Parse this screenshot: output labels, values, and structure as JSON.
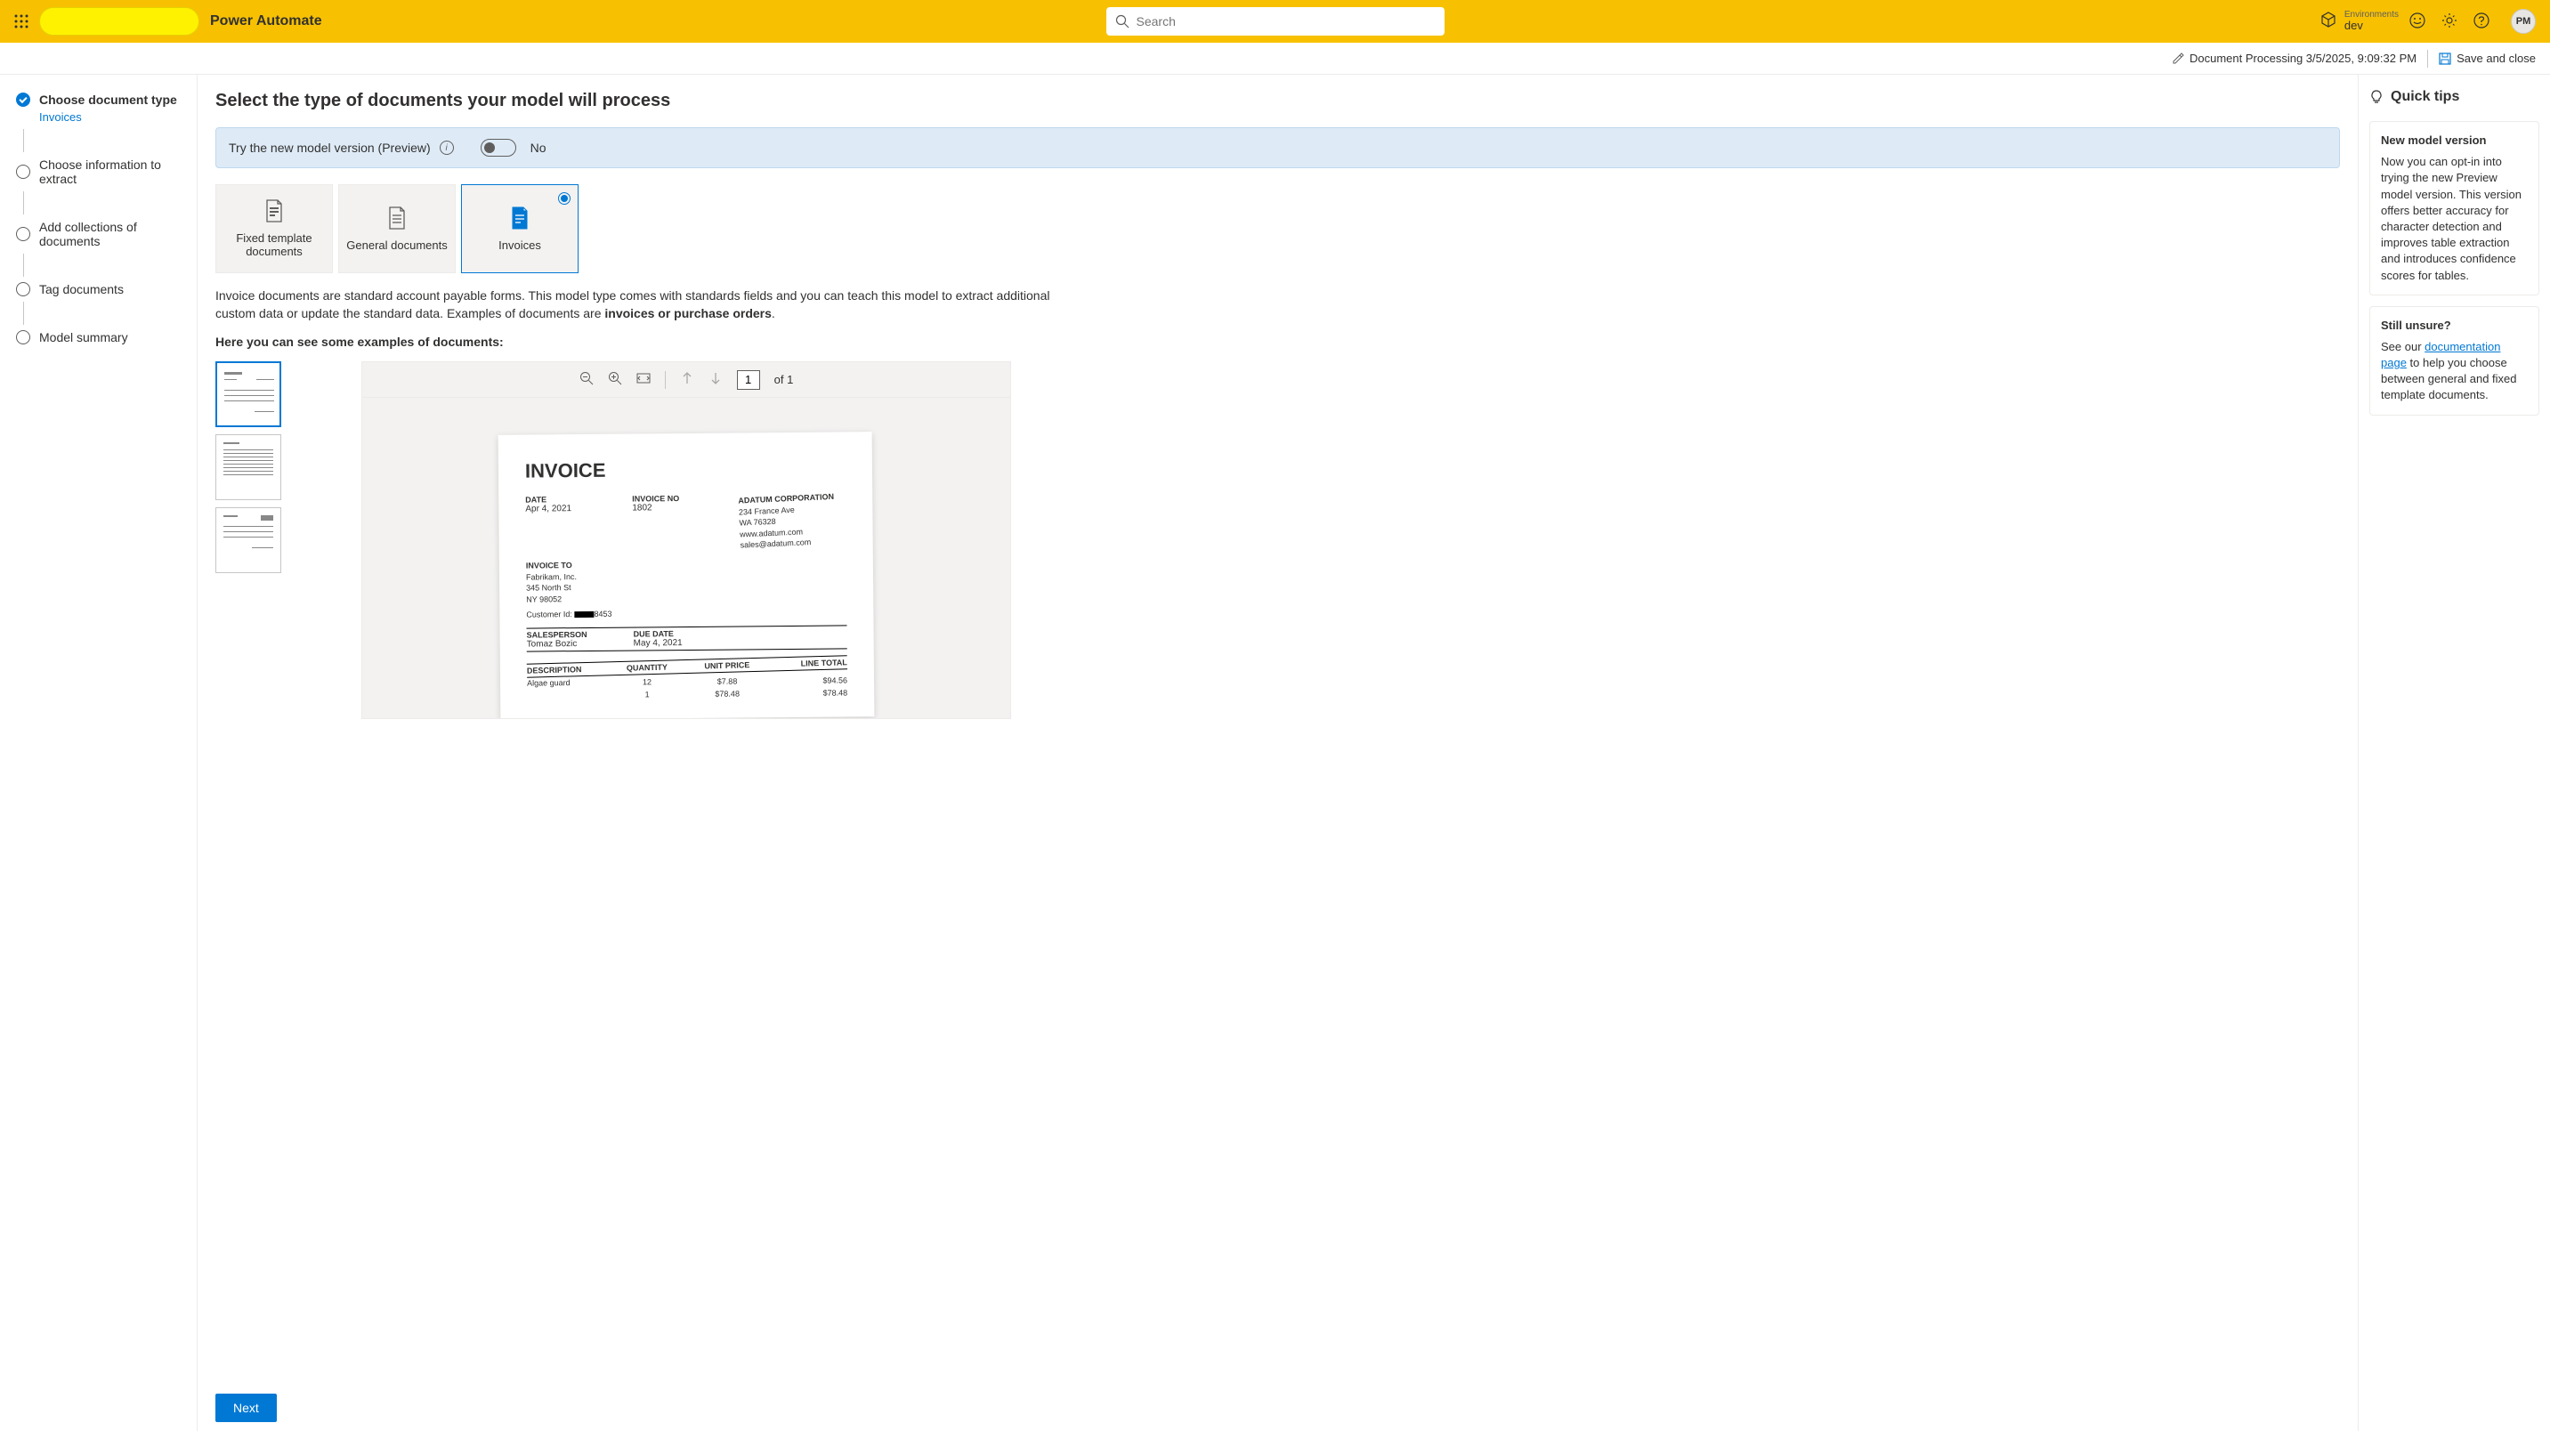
{
  "header": {
    "app_title": "Power Automate",
    "search_placeholder": "Search",
    "env_label": "Environments",
    "env_value": "dev",
    "avatar": "PM"
  },
  "subheader": {
    "doc_title": "Document Processing 3/5/2025, 9:09:32 PM",
    "save_close": "Save and close"
  },
  "sidebar": {
    "steps": [
      {
        "label": "Choose document type",
        "sub": "Invoices",
        "done": true
      },
      {
        "label": "Choose information to extract"
      },
      {
        "label": "Add collections of documents"
      },
      {
        "label": "Tag documents"
      },
      {
        "label": "Model summary"
      }
    ]
  },
  "main": {
    "heading": "Select the type of documents your model will process",
    "preview_text": "Try the new model version (Preview)",
    "toggle_state": "No",
    "cards": {
      "fixed": "Fixed template documents",
      "general": "General documents",
      "invoices": "Invoices"
    },
    "description1": "Invoice documents are standard account payable forms. This model type comes with standards fields and you can teach this model to extract additional custom data or update the standard data. Examples of documents are ",
    "description_bold": "invoices or purchase orders",
    "description_end": ".",
    "examples_label": "Here you can see some examples of documents:",
    "viewer": {
      "page_current": "1",
      "page_total": "of 1"
    },
    "footer": {
      "next": "Next"
    },
    "invoice_doc": {
      "title": "INVOICE",
      "date_lbl": "DATE",
      "date_val": "Apr 4, 2021",
      "inv_no_lbl": "INVOICE NO",
      "inv_no_val": "1802",
      "company": "ADATUM CORPORATION",
      "addr1": "234 France Ave",
      "addr2": "WA 76328",
      "web": "www.adatum.com",
      "email": "sales@adatum.com",
      "to_lbl": "INVOICE TO",
      "to1": "Fabrikam, Inc.",
      "to2": "345 North St",
      "to3": "NY 98052",
      "cust_lbl": "Customer Id:",
      "cust_val": "8453",
      "sales_lbl": "SALESPERSON",
      "sales_val": "Tomaz Bozic",
      "due_lbl": "DUE DATE",
      "due_val": "May 4, 2021",
      "th_desc": "DESCRIPTION",
      "th_qty": "QUANTITY",
      "th_price": "UNIT PRICE",
      "th_total": "LINE TOTAL",
      "r1_desc": "Algae guard",
      "r1_qty": "12",
      "r1_price": "$7.88",
      "r1_total": "$94.56",
      "r2_qty": "1",
      "r2_price": "$78.48",
      "r2_total": "$78.48"
    }
  },
  "tips": {
    "title": "Quick tips",
    "tip1_head": "New model version",
    "tip1_body": "Now you can opt-in into trying the new Preview model version. This version offers better accuracy for character detection and improves table extraction and introduces confidence scores for tables.",
    "tip2_head": "Still unsure?",
    "tip2_pre": "See our ",
    "tip2_link": "documentation page",
    "tip2_post": " to help you choose between general and fixed template documents."
  }
}
